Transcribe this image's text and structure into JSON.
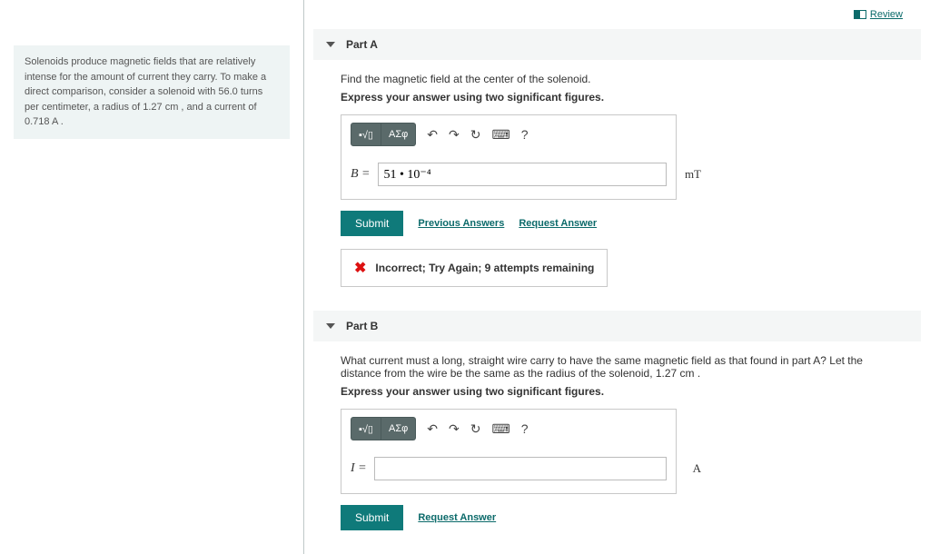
{
  "review_label": "Review",
  "problem_text": "Solenoids produce magnetic fields that are relatively intense for the amount of current they carry. To make a direct comparison, consider a solenoid with 56.0 turns per centimeter, a radius of 1.27 cm , and a current of 0.718 A .",
  "partA": {
    "title": "Part A",
    "prompt": "Find the magnetic field at the center of the solenoid.",
    "instruction": "Express your answer using two significant figures.",
    "variable": "B =",
    "value": "51 • 10⁻⁴",
    "unit": "mT",
    "submit": "Submit",
    "prev_answers": "Previous Answers",
    "request": "Request Answer",
    "feedback": "Incorrect; Try Again; 9 attempts remaining"
  },
  "partB": {
    "title": "Part B",
    "prompt": "What current must a long, straight wire carry to have the same magnetic field as that found in part A? Let the distance from the wire be the same as the radius of the solenoid, 1.27 cm .",
    "instruction": "Express your answer using two significant figures.",
    "variable": "I =",
    "value": "",
    "unit": "A",
    "submit": "Submit",
    "request": "Request Answer"
  },
  "toolbar": {
    "sq": "▪√▯",
    "sym": "ΑΣφ",
    "undo_icon": "↶",
    "redo_icon": "↷",
    "reset_icon": "↻",
    "kbd_icon": "⌨",
    "help_icon": "?"
  }
}
